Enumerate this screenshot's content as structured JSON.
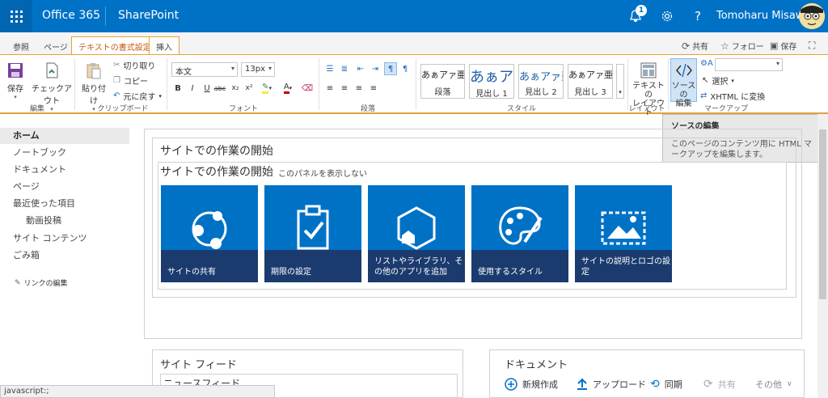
{
  "suite": {
    "brand": "Office 365",
    "app": "SharePoint",
    "notifications": "1",
    "user": "Tomoharu Misawa"
  },
  "ribbon_tabs": {
    "browse": "参照",
    "page": "ページ",
    "format_text": "テキストの書式設定",
    "insert": "挿入"
  },
  "page_actions": {
    "share": "共有",
    "follow": "フォロー",
    "save": "保存"
  },
  "ribbon": {
    "edit_group": {
      "save": "保存",
      "checkout": "チェックアウト",
      "label": "編集"
    },
    "clipboard_group": {
      "paste": "貼り付け",
      "cut": "切り取り",
      "copy": "コピー",
      "undo": "元に戻す",
      "label": "クリップボード"
    },
    "font_group": {
      "font_family": "本文",
      "font_size": "13px",
      "label": "フォント"
    },
    "paragraph_group": {
      "label": "段落"
    },
    "styles_group": {
      "label": "スタイル",
      "styles": [
        {
          "sample": "あぁアァ亜宇",
          "name": "段落"
        },
        {
          "sample": "あぁア",
          "name": "見出し 1"
        },
        {
          "sample": "あぁアァ亜",
          "name": "見出し 2"
        },
        {
          "sample": "あぁアァ亜宇",
          "name": "見出し 3"
        }
      ]
    },
    "layout_group": {
      "text_layout": "テキストの\nレイアウト",
      "label": "レイアウト"
    },
    "markup_group": {
      "edit_source": "ソースの\n編集",
      "select": "選択",
      "convert_xhtml": "XHTML に変換",
      "label": "マークアップ"
    }
  },
  "tooltip": {
    "title": "ソースの編集",
    "body": "このページのコンテンツ用に HTML マークアップを編集します。"
  },
  "nav": {
    "items": [
      {
        "label": "ホーム"
      },
      {
        "label": "ノートブック"
      },
      {
        "label": "ドキュメント"
      },
      {
        "label": "ページ"
      },
      {
        "label": "最近使った項目"
      },
      {
        "label": "動画投稿"
      },
      {
        "label": "サイト コンテンツ"
      },
      {
        "label": "ごみ箱"
      }
    ],
    "edit_links": "リンクの編集"
  },
  "main": {
    "outer_title": "サイトでの作業の開始",
    "inner_title": "サイトでの作業の開始",
    "hide_panel": "このパネルを表示しない",
    "tiles": [
      {
        "label": "サイトの共有",
        "icon": "share-icon"
      },
      {
        "label": "期限の設定",
        "icon": "clipboard-check-icon"
      },
      {
        "label": "リストやライブラリ、その他のアプリを追加",
        "icon": "hexagon-icon"
      },
      {
        "label": "使用するスタイル",
        "icon": "palette-icon"
      },
      {
        "label": "サイトの説明とロゴの設定",
        "icon": "picture-icon"
      }
    ],
    "tile_color": "#0072c6"
  },
  "site_feed": {
    "title": "サイト フィード",
    "newsfeed": "ニュースフィード"
  },
  "documents": {
    "title": "ドキュメント",
    "new": "新規作成",
    "upload": "アップロード",
    "sync": "同期",
    "share": "共有",
    "more": "その他"
  },
  "statusbar": "javascript:;"
}
